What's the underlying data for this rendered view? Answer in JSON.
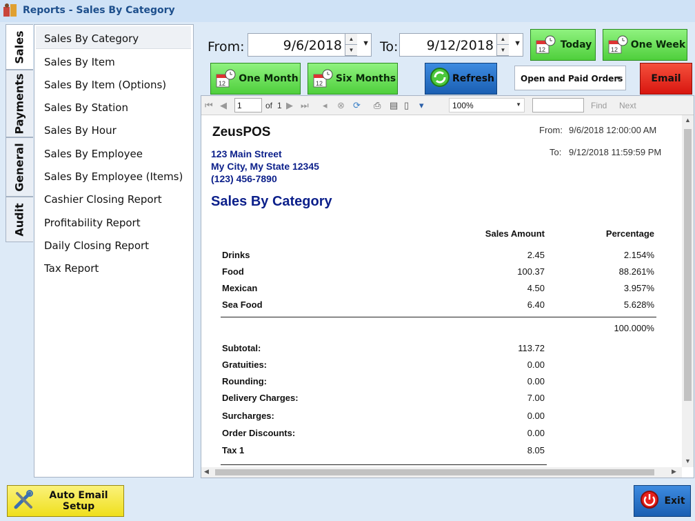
{
  "window": {
    "title": "Reports - Sales By Category"
  },
  "tabs": [
    {
      "label": "Sales"
    },
    {
      "label": "Payments"
    },
    {
      "label": "General"
    },
    {
      "label": "Audit"
    }
  ],
  "sidebar": {
    "items": [
      {
        "label": "Sales By Category"
      },
      {
        "label": "Sales By Item"
      },
      {
        "label": "Sales By Item (Options)"
      },
      {
        "label": "Sales By Station"
      },
      {
        "label": "Sales By Hour"
      },
      {
        "label": "Sales By Employee"
      },
      {
        "label": "Sales By Employee (Items)"
      },
      {
        "label": "Cashier Closing Report"
      },
      {
        "label": "Profitability Report"
      },
      {
        "label": "Daily Closing Report"
      },
      {
        "label": "Tax Report"
      }
    ]
  },
  "controls": {
    "from_label": "From:",
    "from_value": "9/6/2018",
    "to_label": "To:",
    "to_value": "9/12/2018",
    "today": "Today",
    "one_week": "One Week",
    "one_month": "One Month",
    "six_months": "Six Months",
    "refresh": "Refresh",
    "order_filter": "Open and Paid Orders",
    "email": "Email"
  },
  "toolbar": {
    "page": "1",
    "of": "of",
    "total": "1",
    "zoom": "100%",
    "find": "Find",
    "next": "Next"
  },
  "report": {
    "company": "ZeusPOS",
    "address1": "123 Main Street",
    "address2": "My City, My State 12345",
    "phone": "(123) 456-7890",
    "from_label": "From:",
    "from_value": "9/6/2018 12:00:00 AM",
    "to_label": "To:",
    "to_value": "9/12/2018 11:59:59 PM",
    "title": "Sales By Category",
    "col_amount": "Sales Amount",
    "col_percent": "Percentage",
    "rows": [
      {
        "name": "Drinks",
        "amount": "2.45",
        "percent": "2.154%"
      },
      {
        "name": "Food",
        "amount": "100.37",
        "percent": "88.261%"
      },
      {
        "name": "Mexican",
        "amount": "4.50",
        "percent": "3.957%"
      },
      {
        "name": "Sea Food",
        "amount": "6.40",
        "percent": "5.628%"
      }
    ],
    "total_percent": "100.000%",
    "summary": [
      {
        "label": "Subtotal:",
        "value": "113.72"
      },
      {
        "label": "Gratuities:",
        "value": "0.00"
      },
      {
        "label": "Rounding:",
        "value": "0.00"
      },
      {
        "label": "Delivery Charges:",
        "value": "7.00"
      },
      {
        "label": "Surcharges:",
        "value": "0.00"
      },
      {
        "label": "Order Discounts:",
        "value": "0.00"
      },
      {
        "label": "Tax 1",
        "value": "8.05"
      }
    ]
  },
  "footer": {
    "auto_email": "Auto Email Setup",
    "exit": "Exit"
  },
  "colors": {
    "green": "#5fd94b",
    "blue": "#1f6fc2",
    "red": "#e8201c",
    "yellow": "#f5e83a",
    "navy": "#0b1f8a"
  }
}
